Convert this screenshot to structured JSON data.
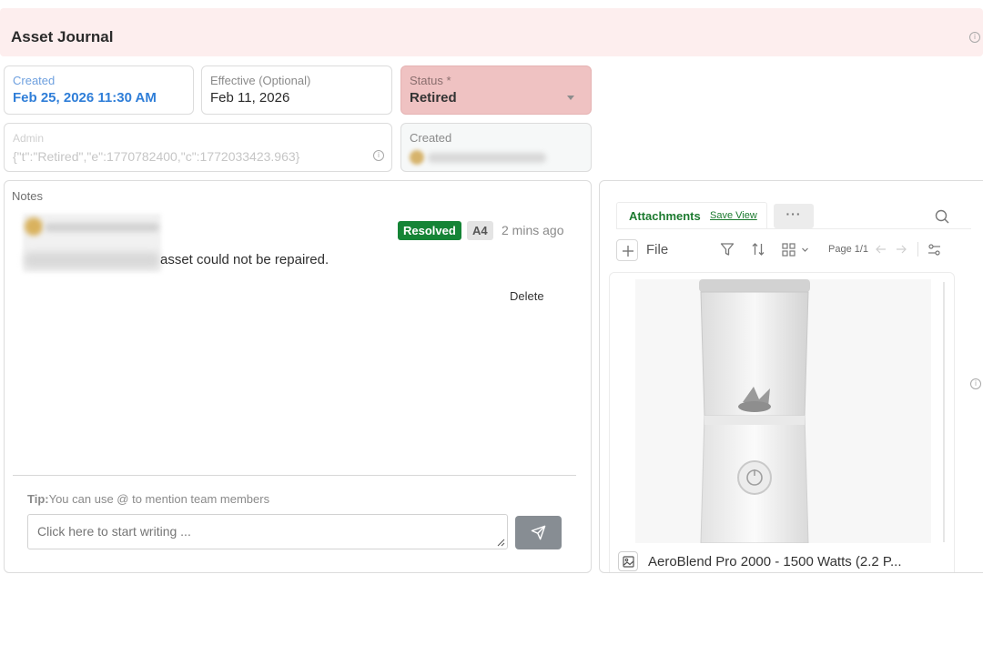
{
  "header": {
    "title": "Asset Journal"
  },
  "fields": {
    "created": {
      "label": "Created",
      "value": "Feb 25, 2026 11:30 AM"
    },
    "effective": {
      "label": "Effective (Optional)",
      "value": "Feb 11, 2026"
    },
    "status": {
      "label": "Status *",
      "value": "Retired"
    },
    "admin": {
      "label": "Admin",
      "value": "{\"t\":\"Retired\",\"e\":1770782400,\"c\":1772033423.963}"
    },
    "created_by": {
      "label": "Created"
    }
  },
  "notes": {
    "label": "Notes",
    "items": [
      {
        "text": "asset could not be repaired.",
        "status_badge": "Resolved",
        "tag": "A4",
        "time": "2 mins ago",
        "delete_label": "Delete"
      }
    ],
    "tip_prefix": "Tip:",
    "tip_text": "You can use @ to mention team members",
    "input_placeholder": "Click here to start writing ..."
  },
  "attachments": {
    "tab_label": "Attachments",
    "save_view_label": "Save View",
    "more_label": "···",
    "add_label": "File",
    "page_label": "Page 1/1",
    "items": [
      {
        "title": "AeroBlend Pro 2000 - 1500 Watts (2.2 P..."
      }
    ]
  },
  "colors": {
    "header_bg": "#fdeeee",
    "status_bg": "#efc2c2",
    "created_value": "#2f7ed8",
    "resolved_badge": "#158436",
    "accent_green": "#1c7a2f"
  },
  "icons": [
    "info-icon",
    "dropdown-caret-icon",
    "send-icon",
    "search-icon",
    "plus-icon",
    "filter-icon",
    "sort-icon",
    "grid-icon",
    "chevron-down-icon",
    "arrow-left-icon",
    "arrow-right-icon",
    "settings-sliders-icon",
    "image-icon"
  ]
}
